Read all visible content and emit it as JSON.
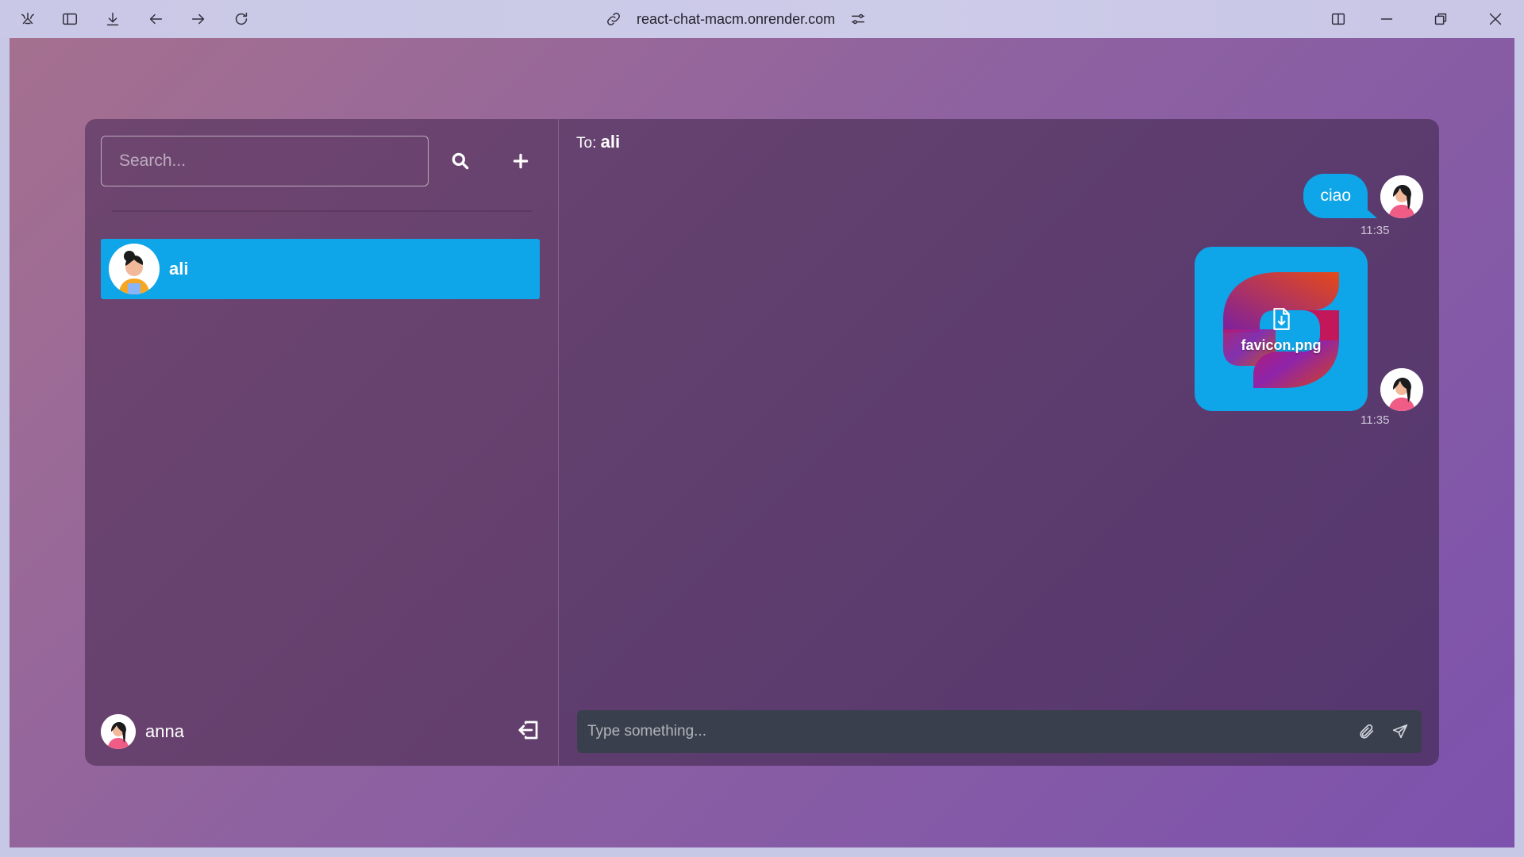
{
  "browser": {
    "url": "react-chat-macm.onrender.com",
    "toolbar_icons": [
      "app-menu-icon",
      "sidebar-icon",
      "download-icon",
      "back-icon",
      "forward-icon",
      "reload-icon"
    ],
    "window_icons": [
      "split-view-icon",
      "minimize-icon",
      "restore-icon",
      "close-icon"
    ]
  },
  "sidebar": {
    "search_placeholder": "Search...",
    "contacts": [
      {
        "name": "ali",
        "selected": true
      }
    ],
    "current_user": {
      "name": "anna"
    }
  },
  "chat": {
    "to_label": "To:",
    "recipient": "ali",
    "messages": [
      {
        "type": "text",
        "text": "ciao",
        "time": "11:35"
      },
      {
        "type": "file",
        "filename": "favicon.png",
        "time": "11:35"
      }
    ],
    "composer_placeholder": "Type something..."
  },
  "colors": {
    "accent": "#0ea5e9",
    "composer_bg": "#3a3f4d",
    "panel_bg": "#5f3e6e"
  }
}
